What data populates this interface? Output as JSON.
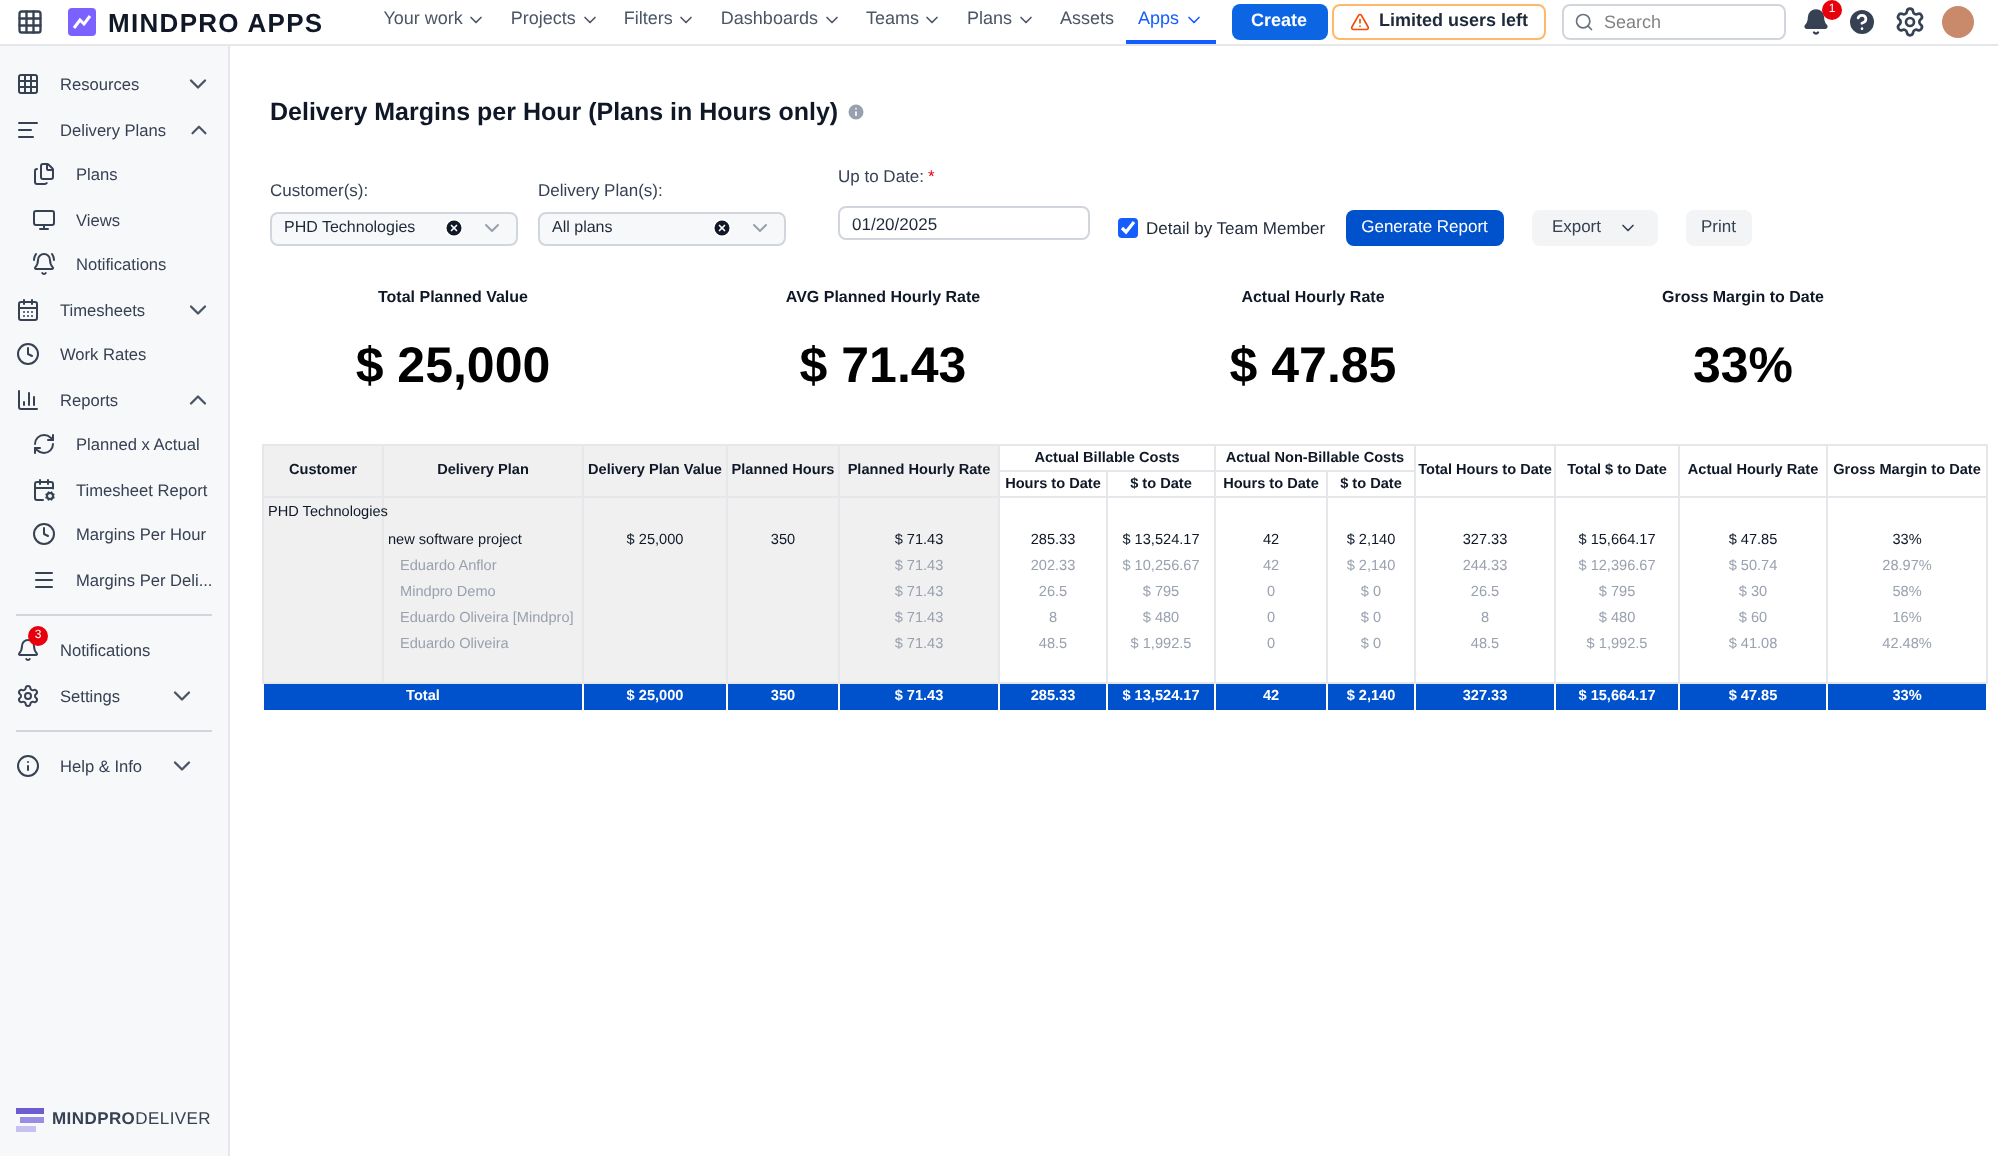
{
  "topbar": {
    "logo": "MINDPRO APPS",
    "nav": [
      {
        "label": "Your work",
        "dropdown": true,
        "selected": false
      },
      {
        "label": "Projects",
        "dropdown": true,
        "selected": false
      },
      {
        "label": "Filters",
        "dropdown": true,
        "selected": false
      },
      {
        "label": "Dashboards",
        "dropdown": true,
        "selected": false
      },
      {
        "label": "Teams",
        "dropdown": true,
        "selected": false
      },
      {
        "label": "Plans",
        "dropdown": true,
        "selected": false
      },
      {
        "label": "Assets",
        "dropdown": false,
        "selected": false
      },
      {
        "label": "Apps",
        "dropdown": true,
        "selected": true
      }
    ],
    "create": "Create",
    "warning": "Limited users left",
    "search": {
      "placeholder": "Search"
    },
    "notification_count": "1"
  },
  "sidebar": {
    "groups": [
      [
        {
          "label": "Resources",
          "expanded": false
        },
        {
          "label": "Delivery Plans",
          "expanded": true,
          "children": [
            {
              "label": "Plans"
            },
            {
              "label": "Views"
            },
            {
              "label": "Notifications"
            }
          ]
        },
        {
          "label": "Timesheets",
          "expanded": false
        },
        {
          "label": "Work Rates"
        },
        {
          "label": "Reports",
          "expanded": true,
          "children": [
            {
              "label": "Planned x Actual"
            },
            {
              "label": "Timesheet Report"
            },
            {
              "label": "Margins Per Hour"
            },
            {
              "label": "Margins Per Deli..."
            }
          ]
        }
      ],
      [
        {
          "label": "Notifications",
          "badge": "3"
        },
        {
          "label": "Settings",
          "expanded": false
        }
      ],
      [
        {
          "label": "Help & Info",
          "expanded": false
        }
      ]
    ],
    "footer": "**MINDPRO**DELIVER"
  },
  "page": {
    "title": "Delivery Margins per Hour (Plans in Hours only)",
    "filters": {
      "customer": {
        "label": "Customer(s):",
        "value": "PHD Technologies"
      },
      "plan": {
        "label": "Delivery Plan(s):",
        "value": "All plans"
      },
      "date": {
        "label": "Up to Date:",
        "required_mark": "*",
        "value": "01/20/2025"
      },
      "detail": {
        "label": "Detail by Team Member",
        "checked": true
      }
    },
    "buttons": {
      "generate": "Generate Report",
      "export": "Export",
      "print": "Print"
    },
    "kpis": [
      {
        "label": "Total Planned Value",
        "value": "$ 25,000"
      },
      {
        "label": "AVG Planned Hourly Rate",
        "value": "$ 71.43"
      },
      {
        "label": "Actual Hourly Rate",
        "value": "$ 47.85"
      },
      {
        "label": "Gross Margin to Date",
        "value": "33%"
      }
    ]
  },
  "table": {
    "columns": [
      "Customer",
      "Delivery Plan",
      "Delivery Plan Value",
      "Planned Hours",
      "Planned Hourly Rate",
      {
        "group": "Actual Billable Costs",
        "colspan": 2,
        "sub": [
          "Hours to Date",
          "$ to Date"
        ]
      },
      {
        "group": "Actual Non-Billable Costs",
        "colspan": 2,
        "sub": [
          "Hours to Date",
          "$ to Date"
        ]
      },
      "Total Hours to Date",
      "Total $ to Date",
      "Actual Hourly Rate",
      "Gross Margin to Date"
    ],
    "rows": [
      {
        "kind": "customer",
        "cells": [
          "PHD Technologies"
        ]
      },
      {
        "kind": "plan",
        "cells": [
          "",
          "new software project",
          "$ 25,000",
          "350",
          "$ 71.43",
          "285.33",
          "$ 13,524.17",
          "42",
          "$ 2,140",
          "327.33",
          "$ 15,664.17",
          "$ 47.85",
          "33%"
        ]
      },
      {
        "kind": "member",
        "cells": [
          "",
          "Eduardo Anflor",
          "",
          "",
          "$ 71.43",
          "202.33",
          "$ 10,256.67",
          "42",
          "$ 2,140",
          "244.33",
          "$ 12,396.67",
          "$ 50.74",
          "28.97%"
        ]
      },
      {
        "kind": "member",
        "cells": [
          "",
          "Mindpro Demo",
          "",
          "",
          "$ 71.43",
          "26.5",
          "$ 795",
          "0",
          "$ 0",
          "26.5",
          "$ 795",
          "$ 30",
          "58%"
        ]
      },
      {
        "kind": "member",
        "cells": [
          "",
          "Eduardo Oliveira [Mindpro]",
          "",
          "",
          "$ 71.43",
          "8",
          "$ 480",
          "0",
          "$ 0",
          "8",
          "$ 480",
          "$ 60",
          "16%"
        ]
      },
      {
        "kind": "member",
        "cells": [
          "",
          "Eduardo Oliveira",
          "",
          "",
          "$ 71.43",
          "48.5",
          "$ 1,992.5",
          "0",
          "$ 0",
          "48.5",
          "$ 1,992.5",
          "$ 41.08",
          "42.48%"
        ]
      }
    ],
    "total": [
      "Total",
      "$ 25,000",
      "350",
      "$ 71.43",
      "285.33",
      "$ 13,524.17",
      "42",
      "$ 2,140",
      "327.33",
      "$ 15,664.17",
      "$ 47.85",
      "33%"
    ]
  }
}
